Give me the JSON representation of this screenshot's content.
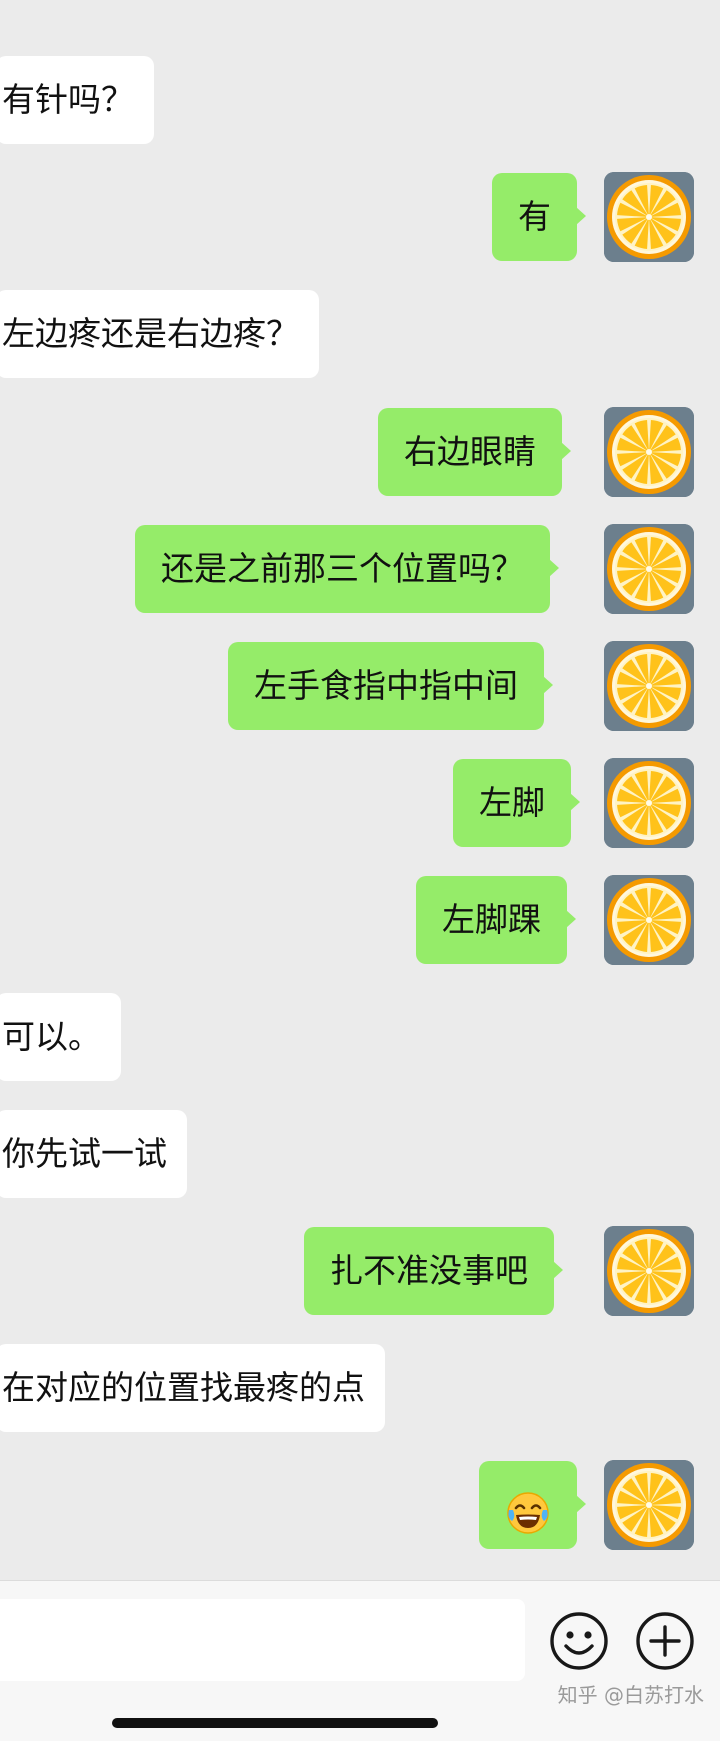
{
  "messages": [
    {
      "side": "left",
      "text": "有针吗？"
    },
    {
      "side": "right",
      "text": "有"
    },
    {
      "side": "left",
      "text": "左边疼还是右边疼？"
    },
    {
      "side": "right",
      "text": "右边眼睛"
    },
    {
      "side": "right",
      "text": "还是之前那三个位置吗？"
    },
    {
      "side": "right",
      "text": "左手食指中指中间"
    },
    {
      "side": "right",
      "text": "左脚"
    },
    {
      "side": "right",
      "text": "左脚踝"
    },
    {
      "side": "left",
      "text": "可以。"
    },
    {
      "side": "left",
      "text": "你先试一试"
    },
    {
      "side": "right",
      "text": "扎不准没事吧"
    },
    {
      "side": "left",
      "text": "在对应的位置找最疼的点"
    },
    {
      "side": "right",
      "emoji": "tears-of-joy-emoji"
    }
  ],
  "avatar": {
    "icon": "orange-slice-avatar",
    "colors": {
      "peel": "#f59a00",
      "flesh": "#ffc21a",
      "background": "#6c7f8d"
    }
  },
  "input_bar": {
    "text_value": "",
    "emoji_button_icon": "smiley-icon",
    "plus_button_icon": "plus-circle-icon"
  },
  "watermark": "知乎 @白苏打水",
  "colors": {
    "background": "#ebebeb",
    "bubble_self": "#95ec69",
    "bubble_other": "#ffffff"
  }
}
